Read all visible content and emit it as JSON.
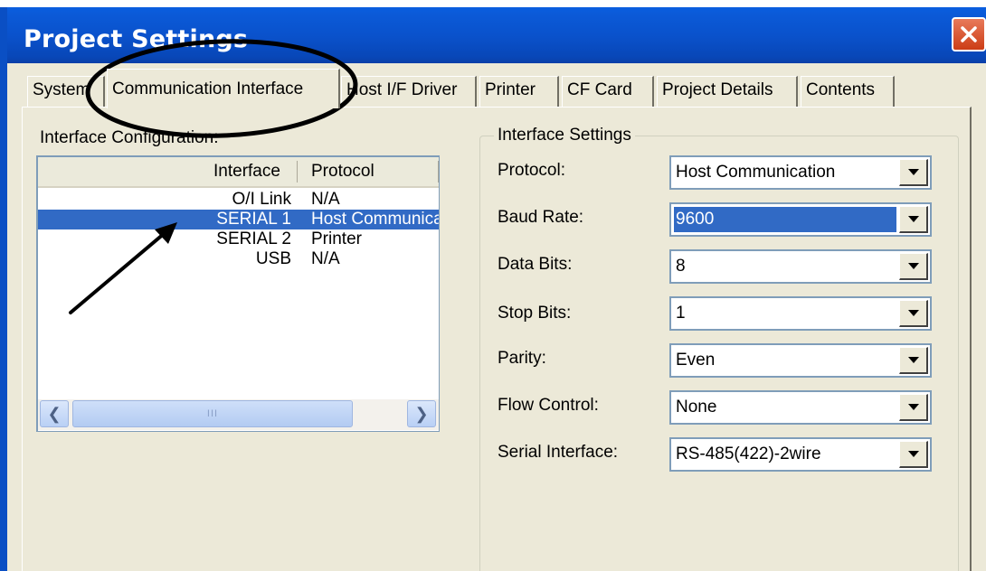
{
  "window": {
    "title": "Project Settings"
  },
  "tabs": [
    {
      "label": "System"
    },
    {
      "label": "Communication Interface",
      "active": true
    },
    {
      "label": "Host I/F Driver"
    },
    {
      "label": "Printer"
    },
    {
      "label": "CF Card"
    },
    {
      "label": "Project Details"
    },
    {
      "label": "Contents"
    }
  ],
  "interface_configuration": {
    "group_label": "Interface Configuration:",
    "columns": [
      "Interface",
      "Protocol"
    ],
    "rows": [
      {
        "interface": "O/I Link",
        "protocol": "N/A"
      },
      {
        "interface": "SERIAL 1",
        "protocol": "Host Communication",
        "selected": true
      },
      {
        "interface": "SERIAL 2",
        "protocol": "Printer"
      },
      {
        "interface": "USB",
        "protocol": "N/A"
      }
    ],
    "scrollbar": {
      "left_icon": "scroll-left-icon",
      "right_icon": "scroll-right-icon",
      "thumb_grip": "III"
    }
  },
  "interface_settings": {
    "group_label": "Interface Settings",
    "fields": [
      {
        "label": "Protocol:",
        "value": "Host Communication"
      },
      {
        "label": "Baud Rate:",
        "value": "9600",
        "focused": true
      },
      {
        "label": "Data Bits:",
        "value": "8"
      },
      {
        "label": "Stop Bits:",
        "value": "1"
      },
      {
        "label": "Parity:",
        "value": "Even"
      },
      {
        "label": "Flow Control:",
        "value": "None"
      },
      {
        "label": "Serial Interface:",
        "value": "RS-485(422)-2wire"
      }
    ]
  },
  "annotations": {
    "ellipse_color": "#000000",
    "arrow_color": "#000000"
  },
  "colors": {
    "titlebar": "#0a52cc",
    "dialog_bg": "#ece9d8",
    "selection": "#316ac5",
    "close_button": "#d9532c"
  }
}
